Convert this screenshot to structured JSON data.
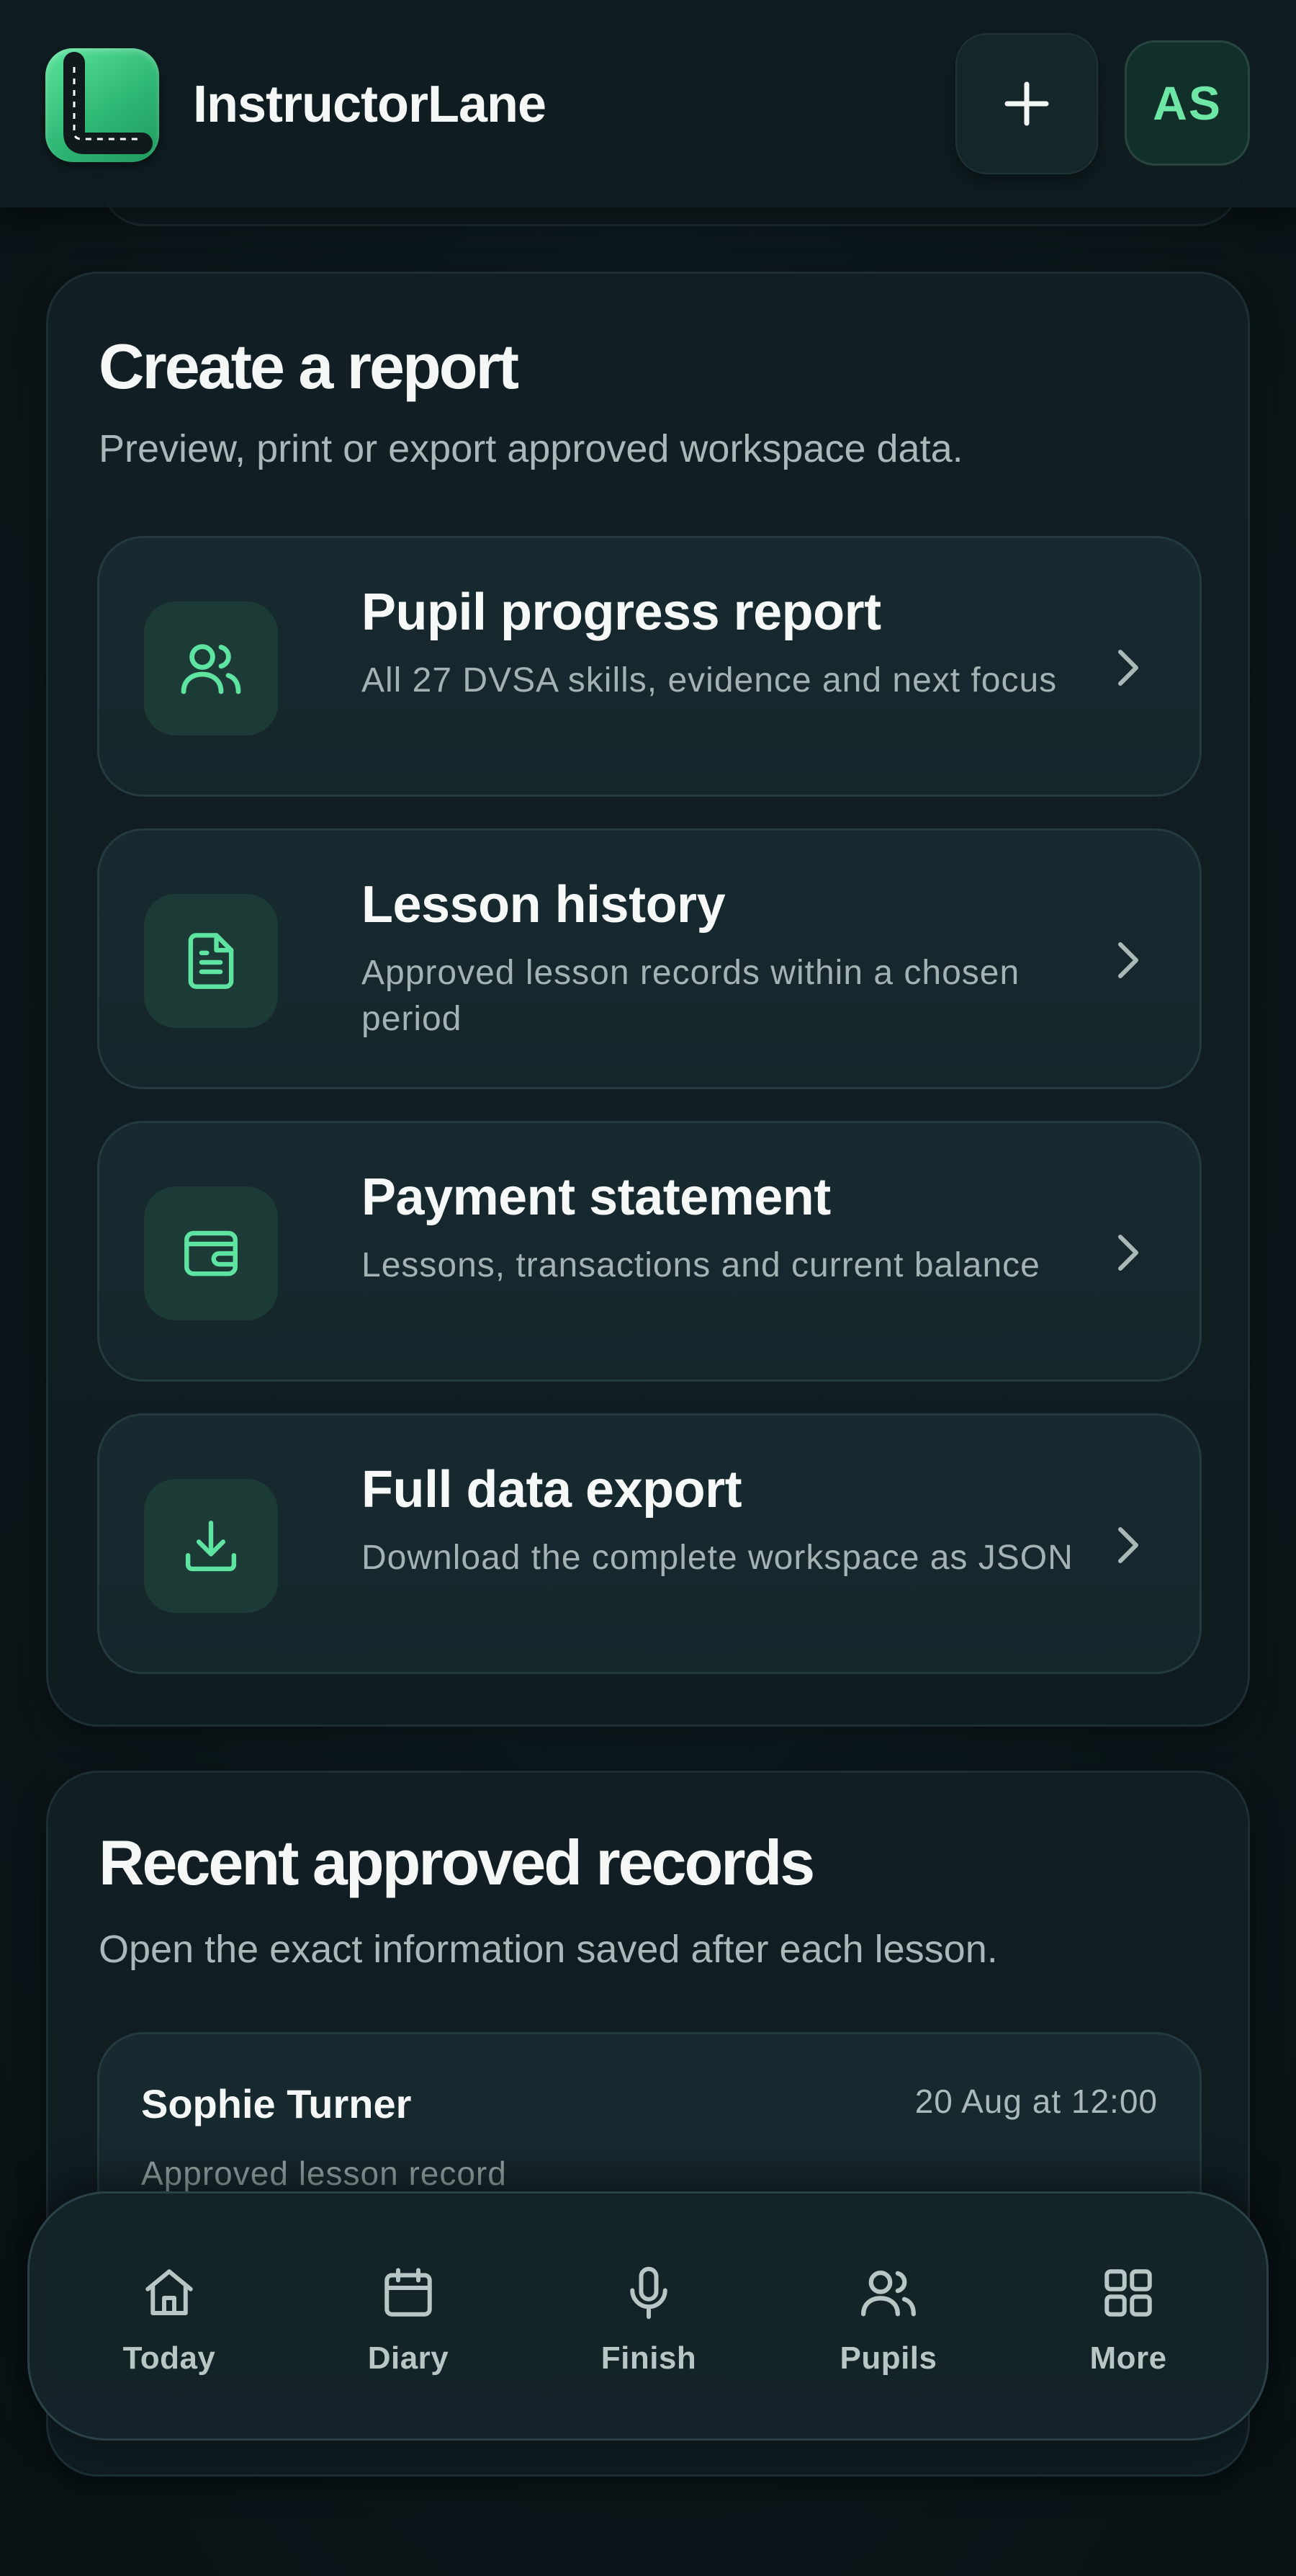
{
  "header": {
    "brand": "InstructorLane",
    "add_icon": "plus-icon",
    "avatar_initials": "AS",
    "accent": "#6ee7a6"
  },
  "report": {
    "title": "Create a report",
    "subtitle": "Preview, print or export approved workspace data.",
    "items": [
      {
        "title": "Pupil progress report",
        "description": "All 27 DVSA skills, evidence and next focus",
        "icon": "users-icon"
      },
      {
        "title": "Lesson history",
        "description": "Approved lesson records within a chosen period",
        "icon": "document-icon"
      },
      {
        "title": "Payment statement",
        "description": "Lessons, transactions and current balance",
        "icon": "wallet-icon"
      },
      {
        "title": "Full data export",
        "description": "Download the complete workspace as JSON",
        "icon": "download-icon"
      }
    ]
  },
  "records": {
    "title": "Recent approved records",
    "subtitle": "Open the exact information saved after each lesson.",
    "items": [
      {
        "name": "Sophie Turner",
        "time": "20 Aug at 12:00",
        "status": "Approved lesson record"
      }
    ]
  },
  "nav": {
    "items": [
      {
        "label": "Today",
        "icon": "home-icon"
      },
      {
        "label": "Diary",
        "icon": "calendar-icon"
      },
      {
        "label": "Finish",
        "icon": "microphone-icon"
      },
      {
        "label": "Pupils",
        "icon": "users-icon"
      },
      {
        "label": "More",
        "icon": "grid-icon"
      }
    ]
  }
}
